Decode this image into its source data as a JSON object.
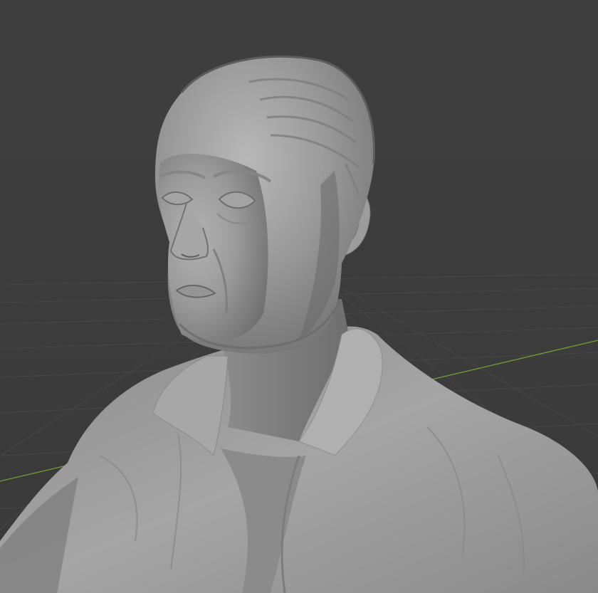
{
  "viewport": {
    "mode": "solid-shading",
    "background_color": "#3d3d3d",
    "grid_color": "#474747",
    "x_axis_color": "#8b8b8b",
    "y_axis_color": "#6f9a2f",
    "object": "head-and-shoulders-sculpt",
    "object_color": "#9a9a9a"
  }
}
